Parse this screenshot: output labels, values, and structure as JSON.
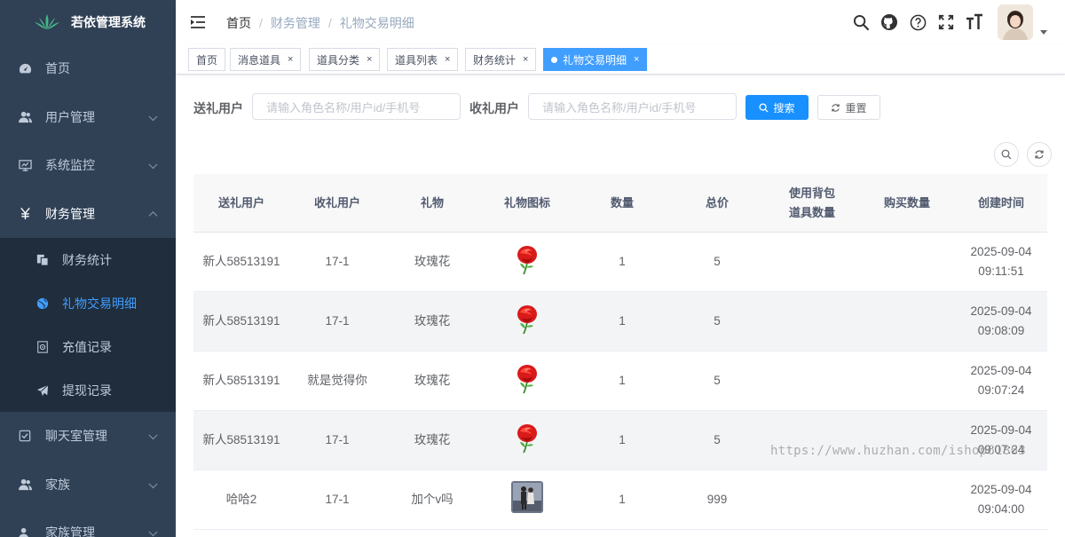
{
  "app": {
    "title": "若依管理系统"
  },
  "sidebar": {
    "items": [
      {
        "label": "首页",
        "icon": "dashboard-icon"
      },
      {
        "label": "用户管理",
        "icon": "user-icon"
      },
      {
        "label": "系统监控",
        "icon": "monitor-icon"
      },
      {
        "label": "财务管理",
        "icon": "yen-icon"
      },
      {
        "label": "聊天室管理",
        "icon": "checkbox-icon"
      },
      {
        "label": "家族",
        "icon": "user-icon"
      },
      {
        "label": "家族管理",
        "icon": "user-icon"
      }
    ],
    "finance_sub": [
      {
        "label": "财务统计",
        "icon": "copy-icon"
      },
      {
        "label": "礼物交易明细",
        "icon": "globe-icon"
      },
      {
        "label": "充值记录",
        "icon": "money-icon"
      },
      {
        "label": "提现记录",
        "icon": "send-icon"
      }
    ]
  },
  "breadcrumb": {
    "first": "首页",
    "second": "财务管理",
    "third": "礼物交易明细"
  },
  "tags": [
    {
      "label": "首页"
    },
    {
      "label": "消息道具"
    },
    {
      "label": "道具分类"
    },
    {
      "label": "道具列表"
    },
    {
      "label": "财务统计"
    },
    {
      "label": "礼物交易明细"
    }
  ],
  "search": {
    "sender_label": "送礼用户",
    "sender_placeholder": "请输入角色名称/用户id/手机号",
    "receiver_label": "收礼用户",
    "receiver_placeholder": "请输入角色名称/用户id/手机号",
    "search_btn": "搜索",
    "reset_btn": "重置"
  },
  "table": {
    "columns": [
      "送礼用户",
      "收礼用户",
      "礼物",
      "礼物图标",
      "数量",
      "总价",
      "使用背包道具数量",
      "购买数量",
      "创建时间"
    ],
    "rows": [
      {
        "sender": "新人58513191",
        "receiver": "17-1",
        "gift": "玫瑰花",
        "icon": "rose",
        "qty": "1",
        "total": "5",
        "bag_qty": "",
        "buy_qty": "",
        "time": "2025-09-04 09:11:51"
      },
      {
        "sender": "新人58513191",
        "receiver": "17-1",
        "gift": "玫瑰花",
        "icon": "rose",
        "qty": "1",
        "total": "5",
        "bag_qty": "",
        "buy_qty": "",
        "time": "2025-09-04 09:08:09"
      },
      {
        "sender": "新人58513191",
        "receiver": "就是觉得你",
        "gift": "玫瑰花",
        "icon": "rose",
        "qty": "1",
        "total": "5",
        "bag_qty": "",
        "buy_qty": "",
        "time": "2025-09-04 09:07:24"
      },
      {
        "sender": "新人58513191",
        "receiver": "17-1",
        "gift": "玫瑰花",
        "icon": "rose",
        "qty": "1",
        "total": "5",
        "bag_qty": "",
        "buy_qty": "",
        "time": "2025-09-04 09:07:24"
      },
      {
        "sender": "哈哈2",
        "receiver": "17-1",
        "gift": "加个v吗",
        "icon": "photo",
        "qty": "1",
        "total": "999",
        "bag_qty": "",
        "buy_qty": "",
        "time": "2025-09-04 09:04:00"
      }
    ]
  },
  "watermark": "https://www.huzhan.com/ishop61863"
}
